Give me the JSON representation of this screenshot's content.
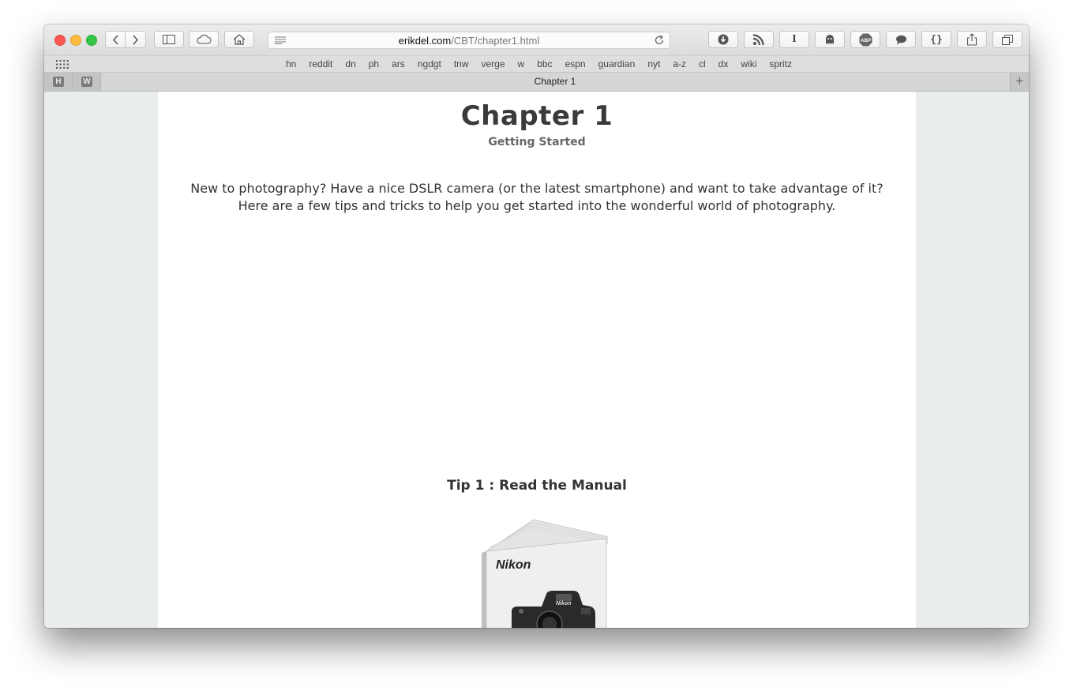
{
  "browser": {
    "url_host": "erikdel.com",
    "url_path": "/CBT/chapter1.html",
    "favorites": [
      "hn",
      "reddit",
      "dn",
      "ph",
      "ars",
      "ngdgt",
      "tnw",
      "verge",
      "w",
      "bbc",
      "espn",
      "guardian",
      "nyt",
      "a-z",
      "cl",
      "dx",
      "wiki",
      "spritz"
    ],
    "pinned_tabs": [
      "H",
      "W"
    ],
    "active_tab_title": "Chapter 1",
    "new_tab_label": "+",
    "extension_labels": {
      "text_cursor": "I",
      "adblock": "ABP",
      "braces": "{}"
    }
  },
  "page": {
    "title": "Chapter 1",
    "subtitle": "Getting Started",
    "intro_line1": "New to photography? Have a nice DSLR camera (or the latest smartphone) and want to take advantage of it?",
    "intro_line2": "Here are a few tips and tricks to help you get started into the wonderful world of photography.",
    "tip1_title": "Tip 1 : Read the Manual",
    "manual_brand": "Nikon",
    "manual_camera_brand": "Nikon"
  }
}
